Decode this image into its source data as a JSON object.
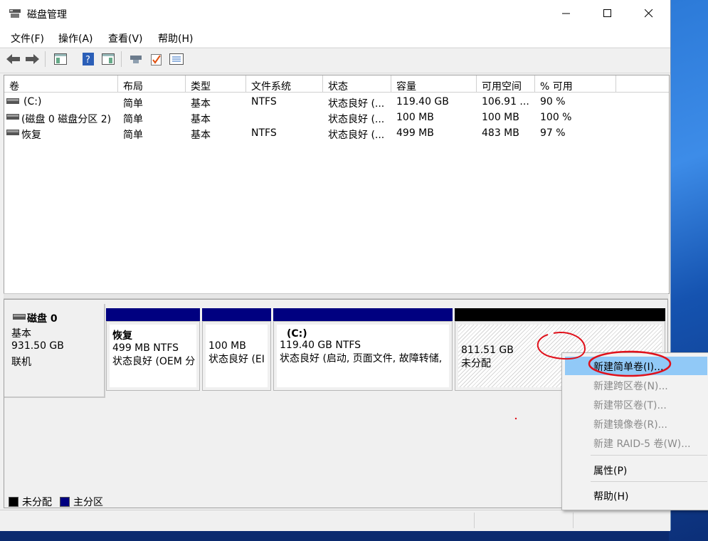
{
  "window": {
    "title": "磁盘管理"
  },
  "menu": [
    "文件(F)",
    "操作(A)",
    "查看(V)",
    "帮助(H)"
  ],
  "toolbar_icons": [
    "back-icon",
    "forward-icon",
    "console-tree-icon",
    "help-icon",
    "show-pane-icon",
    "connect-disk-icon",
    "check-icon",
    "properties-list-icon"
  ],
  "volumes": {
    "headers": [
      "卷",
      "布局",
      "类型",
      "文件系统",
      "状态",
      "容量",
      "可用空间",
      "% 可用"
    ],
    "rows": [
      [
        "(C:)",
        "简单",
        "基本",
        "NTFS",
        "状态良好 (...",
        "119.40 GB",
        "106.91 ...",
        "90 %"
      ],
      [
        "(磁盘 0 磁盘分区 2)",
        "简单",
        "基本",
        "",
        "状态良好 (...",
        "100 MB",
        "100 MB",
        "100 %"
      ],
      [
        "恢复",
        "简单",
        "基本",
        "NTFS",
        "状态良好 (...",
        "499 MB",
        "483 MB",
        "97 %"
      ]
    ]
  },
  "disk": {
    "name": "磁盘 0",
    "type": "基本",
    "size": "931.50 GB",
    "state": "联机",
    "partitions": [
      {
        "title": "恢复",
        "size": "499 MB NTFS",
        "status": "状态良好 (OEM 分",
        "kind": "primary"
      },
      {
        "title": "",
        "size": "100 MB",
        "status": "状态良好 (EI",
        "kind": "primary"
      },
      {
        "title": "(C:)",
        "size": "119.40 GB NTFS",
        "status": "状态良好 (启动, 页面文件, 故障转储,",
        "kind": "primary"
      },
      {
        "title": "",
        "size": "811.51 GB",
        "status": "未分配",
        "kind": "unallocated"
      }
    ]
  },
  "legend": [
    {
      "label": "未分配",
      "color": "#000000"
    },
    {
      "label": "主分区",
      "color": "#000080"
    }
  ],
  "context_menu": {
    "items": [
      {
        "label": "新建简单卷(I)...",
        "state": "highlighted"
      },
      {
        "label": "新建跨区卷(N)...",
        "state": "disabled"
      },
      {
        "label": "新建带区卷(T)...",
        "state": "disabled"
      },
      {
        "label": "新建镜像卷(R)...",
        "state": "disabled"
      },
      {
        "label": "新建 RAID-5 卷(W)...",
        "state": "disabled"
      },
      {
        "label": "属性(P)",
        "state": "enabled"
      },
      {
        "label": "帮助(H)",
        "state": "enabled"
      }
    ]
  },
  "colors": {
    "primary_partition": "#000080",
    "unallocated": "#000000",
    "menu_highlight": "#91c9f7",
    "annotation": "#e0101a"
  }
}
